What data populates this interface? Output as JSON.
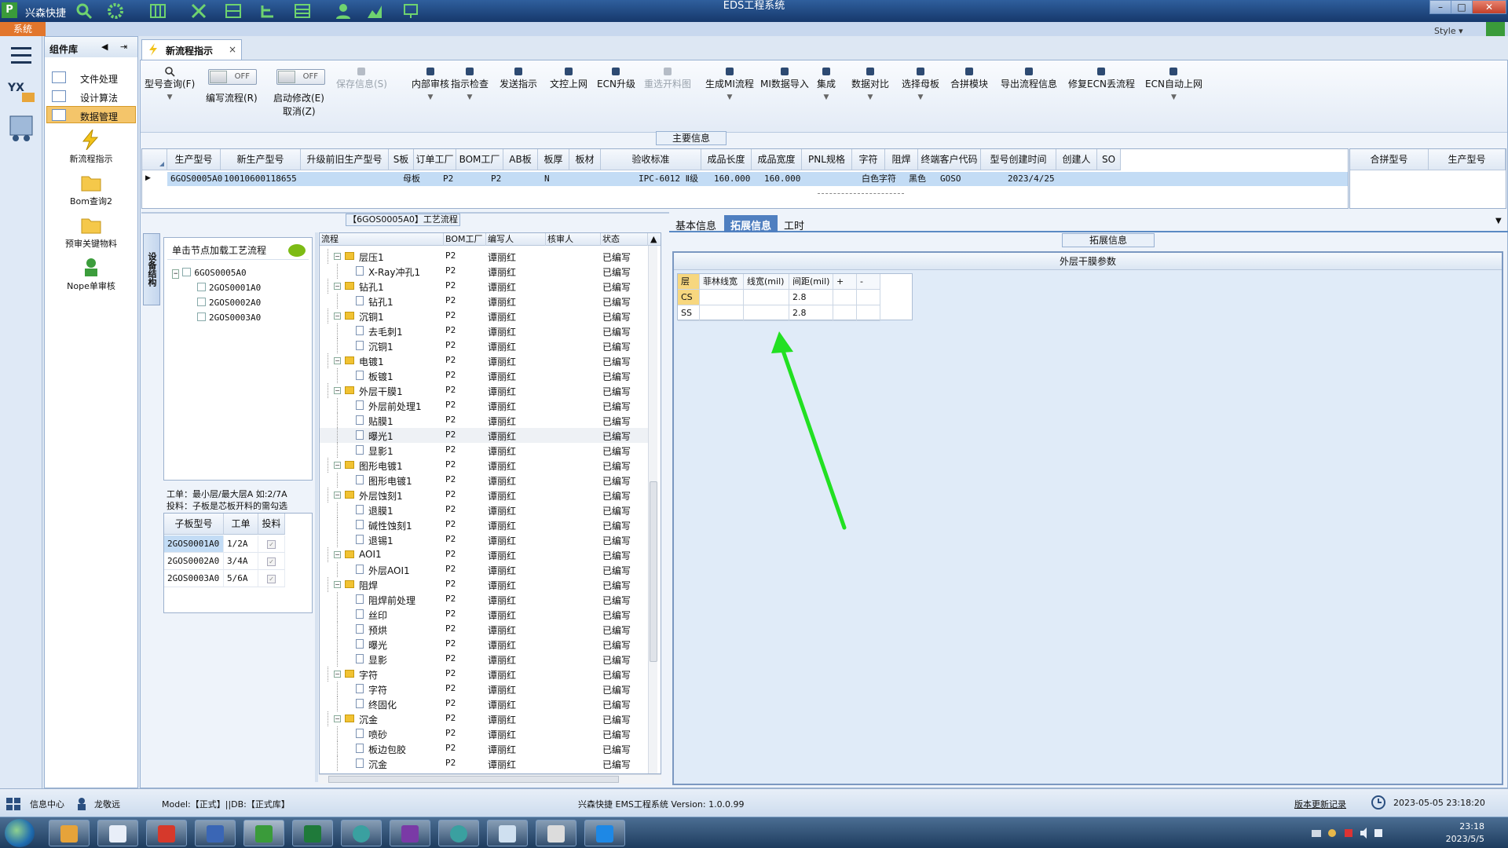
{
  "titlebar": {
    "app_name": "兴森快捷",
    "window_title": "EDS工程系统",
    "min": "–",
    "max": "□",
    "close": "✕"
  },
  "menu": {
    "system": "系统",
    "style": "Style ▾"
  },
  "components": {
    "header": "组件库",
    "nav": [
      {
        "label": "文件处理"
      },
      {
        "label": "设计算法"
      },
      {
        "label": "数据管理"
      }
    ],
    "tools": [
      {
        "label": "新流程指示"
      },
      {
        "label": "Bom查询2"
      },
      {
        "label": "预审关键物料"
      },
      {
        "label": "Nope单审核"
      }
    ]
  },
  "doc_tab": {
    "label": "新流程指示",
    "close": "×"
  },
  "toolbar": {
    "model_query": "型号查询(F)",
    "toggle1": {
      "state": "OFF",
      "label": "编写流程(R)"
    },
    "toggle2": {
      "state": "OFF",
      "label": "启动修改(E)",
      "sub": "取消(Z)"
    },
    "buttons": [
      {
        "label": "保存信息(S)"
      },
      {
        "label": "内部审核"
      },
      {
        "label": "指示检查"
      },
      {
        "label": "发送指示"
      },
      {
        "label": "文控上网"
      },
      {
        "label": "ECN升级"
      },
      {
        "label": "重选开料图"
      },
      {
        "label": "生成MI流程"
      },
      {
        "label": "MI数据导入"
      },
      {
        "label": "集成"
      },
      {
        "label": "数据对比"
      },
      {
        "label": "选择母板"
      },
      {
        "label": "合拼模块"
      },
      {
        "label": "导出流程信息"
      },
      {
        "label": "修复ECN丢流程"
      },
      {
        "label": "ECN自动上网"
      }
    ]
  },
  "main_info": {
    "title": "主要信息",
    "columns": [
      "生产型号",
      "新生产型号",
      "升级前旧生产型号",
      "S板",
      "订单工厂",
      "BOM工厂",
      "AB板",
      "板厚",
      "板材",
      "验收标准",
      "成品长度",
      "成品宽度",
      "PNL规格",
      "字符",
      "阻焊",
      "终端客户代码",
      "型号创建时间",
      "创建人",
      "SO"
    ],
    "row": {
      "prod_model": "6GOS0005A0",
      "new_model": "10010600118655",
      "s_board": "母板",
      "order_factory": "P2",
      "bom_factory": "P2",
      "ab_board": "N",
      "standard": "IPC-6012 Ⅱ级",
      "length": "160.000",
      "width": "160.000",
      "char": "白色字符",
      "mask": "黑色",
      "customer": "GOSO",
      "created": "2023/4/25"
    },
    "side_columns": [
      "合拼型号",
      "生产型号"
    ]
  },
  "process": {
    "title": "【6GOS0005A0】工艺流程",
    "vtab": "设备结构",
    "hint": "单击节点加载工艺流程",
    "tree": [
      {
        "label": "6GOS0005A0"
      },
      {
        "label": "2GOS0001A0"
      },
      {
        "label": "2GOS0002A0"
      },
      {
        "label": "2GOS0003A0"
      }
    ],
    "note1": "工单：最小层/最大层A 如:2/7A",
    "note2": "投料：子板是芯板开料的需勾选",
    "sub_columns": [
      "子板型号",
      "工单",
      "投料"
    ],
    "sub_rows": [
      {
        "model": "2GOS0001A0",
        "order": "1/2A",
        "feed": true
      },
      {
        "model": "2GOS0002A0",
        "order": "3/4A",
        "feed": true
      },
      {
        "model": "2GOS0003A0",
        "order": "5/6A",
        "feed": true
      }
    ]
  },
  "flow": {
    "columns": [
      "流程",
      "BOM工厂",
      "编写人",
      "核审人",
      "状态"
    ],
    "factory": "P2",
    "author": "谭丽红",
    "status": "已编写",
    "rows": [
      {
        "name": "层压1",
        "type": "folder",
        "level": 1
      },
      {
        "name": "X-Ray冲孔1",
        "type": "doc",
        "level": 2
      },
      {
        "name": "钻孔1",
        "type": "folder",
        "level": 1
      },
      {
        "name": "钻孔1",
        "type": "doc",
        "level": 2
      },
      {
        "name": "沉铜1",
        "type": "folder",
        "level": 1
      },
      {
        "name": "去毛刺1",
        "type": "doc",
        "level": 2
      },
      {
        "name": "沉铜1",
        "type": "doc",
        "level": 2
      },
      {
        "name": "电镀1",
        "type": "folder",
        "level": 1
      },
      {
        "name": "板镀1",
        "type": "doc",
        "level": 2
      },
      {
        "name": "外层干膜1",
        "type": "folder",
        "level": 1
      },
      {
        "name": "外层前处理1",
        "type": "doc",
        "level": 2
      },
      {
        "name": "贴膜1",
        "type": "doc",
        "level": 2
      },
      {
        "name": "曝光1",
        "type": "doc",
        "level": 2
      },
      {
        "name": "显影1",
        "type": "doc",
        "level": 2
      },
      {
        "name": "图形电镀1",
        "type": "folder",
        "level": 1
      },
      {
        "name": "图形电镀1",
        "type": "doc",
        "level": 2
      },
      {
        "name": "外层蚀刻1",
        "type": "folder",
        "level": 1
      },
      {
        "name": "退膜1",
        "type": "doc",
        "level": 2
      },
      {
        "name": "碱性蚀刻1",
        "type": "doc",
        "level": 2
      },
      {
        "name": "退锡1",
        "type": "doc",
        "level": 2
      },
      {
        "name": "AOI1",
        "type": "folder",
        "level": 1
      },
      {
        "name": "外层AOI1",
        "type": "doc",
        "level": 2
      },
      {
        "name": "阻焊",
        "type": "folder",
        "level": 1
      },
      {
        "name": "阻焊前处理",
        "type": "doc",
        "level": 2
      },
      {
        "name": "丝印",
        "type": "doc",
        "level": 2
      },
      {
        "name": "预烘",
        "type": "doc",
        "level": 2
      },
      {
        "name": "曝光",
        "type": "doc",
        "level": 2
      },
      {
        "name": "显影",
        "type": "doc",
        "level": 2
      },
      {
        "name": "字符",
        "type": "folder",
        "level": 1
      },
      {
        "name": "字符",
        "type": "doc",
        "level": 2
      },
      {
        "name": "终固化",
        "type": "doc",
        "level": 2
      },
      {
        "name": "沉金",
        "type": "folder",
        "level": 1
      },
      {
        "name": "喷砂",
        "type": "doc",
        "level": 2
      },
      {
        "name": "板边包胶",
        "type": "doc",
        "level": 2
      },
      {
        "name": "沉金",
        "type": "doc",
        "level": 2
      }
    ]
  },
  "right": {
    "tabs": [
      {
        "label": "基本信息"
      },
      {
        "label": "拓展信息"
      },
      {
        "label": "工时"
      }
    ],
    "ext_label": "拓展信息",
    "param_title": "外层干膜参数",
    "param_columns": [
      "层",
      "菲林线宽",
      "线宽(mil)",
      "间距(mil)",
      "+",
      "-"
    ],
    "param_rows": [
      {
        "layer": "CS",
        "spacing": "2.8"
      },
      {
        "layer": "SS",
        "spacing": "2.8"
      }
    ]
  },
  "status": {
    "info_center": "信息中心",
    "user": "龙敬远",
    "model_db": "Model:【正式】||DB:【正式库】",
    "version": "兴森快捷 EMS工程系统 Version: 1.0.0.99",
    "changelog": "版本更新记录",
    "datetime": "2023-05-05 23:18:20"
  },
  "taskbar": {
    "time": "23:18",
    "date": "2023/5/5"
  },
  "colors": {
    "accent": "#4f7fc0",
    "selection": "#c3dcf5",
    "nav_selected": "#f4c56a",
    "arrow": "#22e022"
  }
}
